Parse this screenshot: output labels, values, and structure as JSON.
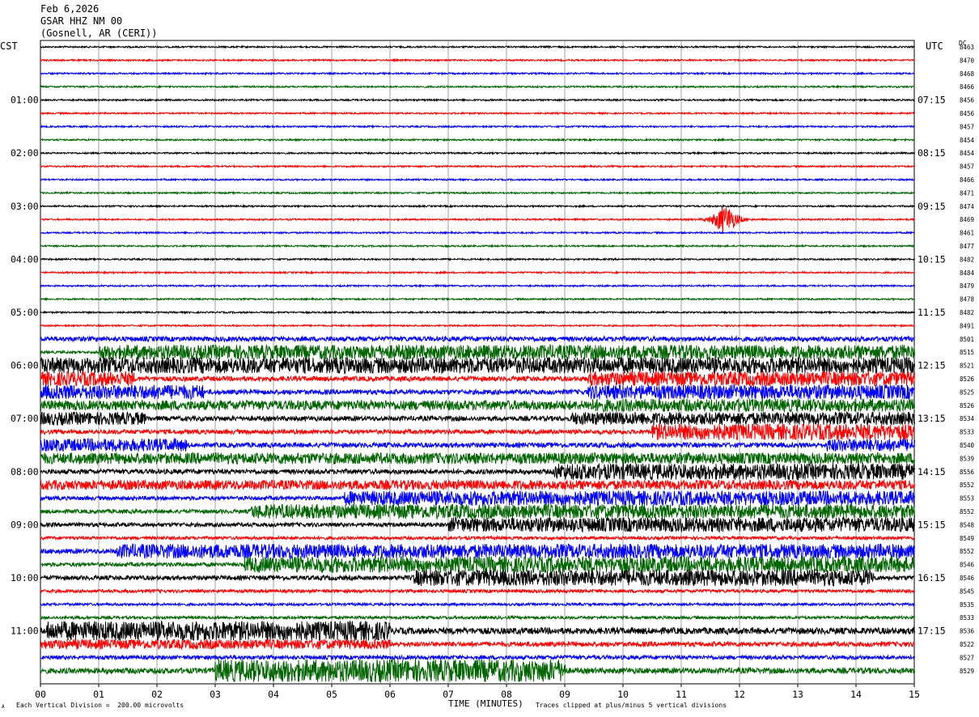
{
  "header": {
    "date": "Feb 6,2026",
    "station": "GSAR HHZ NM 00",
    "location": "(Gosnell, AR (CERI))"
  },
  "left_tz": "CST",
  "right_tz": "UTC",
  "dc_label": "DC",
  "xlabel": "TIME (MINUTES)",
  "footer": {
    "left": "Each Vertical Division =  200.00 microvolts",
    "right": "Traces clipped at plus/minus 5 vertical divisions",
    "corner": "A"
  },
  "chart_data": {
    "type": "line",
    "title": "",
    "x_range": [
      0,
      15
    ],
    "x_ticks": [
      "00",
      "01",
      "02",
      "03",
      "04",
      "05",
      "06",
      "07",
      "08",
      "09",
      "10",
      "11",
      "12",
      "13",
      "14",
      "15"
    ],
    "trace_colors": [
      "#000000",
      "#ff0000",
      "#0000ff",
      "#006400"
    ],
    "left_hour_labels": [
      "01:00",
      "02:00",
      "03:00",
      "04:00",
      "05:00",
      "06:00",
      "07:00",
      "08:00",
      "09:00",
      "10:00",
      "11:00"
    ],
    "right_hour_labels": [
      "07:15",
      "08:15",
      "09:15",
      "10:15",
      "11:15",
      "12:15",
      "13:15",
      "14:15",
      "15:15",
      "16:15",
      "17:15"
    ],
    "dc_offsets": [
      "8463",
      "8470",
      "8468",
      "8466",
      "8456",
      "8456",
      "8457",
      "8454",
      "8454",
      "8457",
      "8466",
      "8471",
      "8474",
      "8469",
      "8461",
      "8477",
      "8482",
      "8484",
      "8479",
      "8478",
      "8482",
      "8491",
      "8501",
      "8515",
      "8521",
      "8526",
      "8525",
      "8526",
      "8534",
      "8533",
      "8540",
      "8539",
      "8556",
      "8552",
      "8553",
      "8552",
      "8548",
      "8549",
      "8552",
      "8546",
      "8546",
      "8545",
      "8535",
      "8533",
      "8536",
      "8522",
      "8527",
      "8529"
    ],
    "trace_amplitude": [
      1,
      1,
      1,
      1,
      1,
      1,
      1,
      1,
      1,
      1,
      1,
      1,
      1,
      1,
      1,
      1,
      1,
      1,
      1,
      1,
      1,
      1,
      1.2,
      1.5,
      4,
      3,
      3,
      3,
      3,
      2.8,
      3,
      2.8,
      3,
      3,
      2.5,
      2.5,
      2.5,
      2,
      3,
      2.5,
      2.8,
      2,
      1.6,
      1.8,
      4,
      3,
      2.5,
      3.5
    ],
    "noise_bursts": [
      {
        "trace": 22,
        "from": 0.0,
        "to": 15.0,
        "amp": 3
      },
      {
        "trace": 23,
        "from": 1.0,
        "to": 15.0,
        "amp": 9
      },
      {
        "trace": 24,
        "from": 0.0,
        "to": 15.0,
        "amp": 10
      },
      {
        "trace": 25,
        "from": 0.0,
        "to": 1.6,
        "amp": 9
      },
      {
        "trace": 25,
        "from": 9.4,
        "to": 15.0,
        "amp": 9
      },
      {
        "trace": 26,
        "from": 0.0,
        "to": 2.8,
        "amp": 9
      },
      {
        "trace": 26,
        "from": 9.4,
        "to": 15.0,
        "amp": 9
      },
      {
        "trace": 27,
        "from": 0.0,
        "to": 9.4,
        "amp": 6
      },
      {
        "trace": 27,
        "from": 9.4,
        "to": 15.0,
        "amp": 8
      },
      {
        "trace": 28,
        "from": 0.0,
        "to": 1.8,
        "amp": 8
      },
      {
        "trace": 28,
        "from": 9.1,
        "to": 15.0,
        "amp": 8
      },
      {
        "trace": 29,
        "from": 10.5,
        "to": 15.0,
        "amp": 10
      },
      {
        "trace": 30,
        "from": 0.0,
        "to": 2.5,
        "amp": 8
      },
      {
        "trace": 30,
        "from": 13.5,
        "to": 15.0,
        "amp": 8
      },
      {
        "trace": 31,
        "from": 0.0,
        "to": 15.0,
        "amp": 7
      },
      {
        "trace": 32,
        "from": 8.8,
        "to": 15.0,
        "amp": 10
      },
      {
        "trace": 33,
        "from": 0.0,
        "to": 15.0,
        "amp": 6
      },
      {
        "trace": 34,
        "from": 5.2,
        "to": 15.0,
        "amp": 9
      },
      {
        "trace": 35,
        "from": 3.6,
        "to": 15.0,
        "amp": 9
      },
      {
        "trace": 36,
        "from": 7.0,
        "to": 15.0,
        "amp": 9
      },
      {
        "trace": 38,
        "from": 1.3,
        "to": 15.0,
        "amp": 9
      },
      {
        "trace": 39,
        "from": 3.5,
        "to": 15.0,
        "amp": 10
      },
      {
        "trace": 40,
        "from": 6.4,
        "to": 14.3,
        "amp": 10
      },
      {
        "trace": 44,
        "from": 0.1,
        "to": 6.0,
        "amp": 12
      },
      {
        "trace": 45,
        "from": 0.0,
        "to": 6.0,
        "amp": 6
      },
      {
        "trace": 47,
        "from": 3.0,
        "to": 9.0,
        "amp": 14
      }
    ],
    "events": [
      {
        "trace": 13,
        "minute": 11.75,
        "amp": 28
      }
    ]
  }
}
